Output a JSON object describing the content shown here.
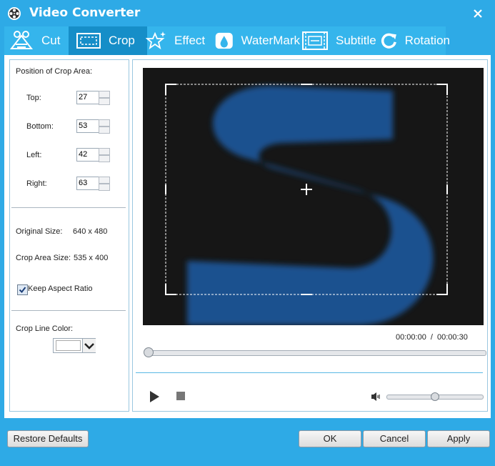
{
  "window": {
    "title": "Video Converter"
  },
  "tabs": [
    {
      "label": "Cut",
      "icon": "cut-icon",
      "active": false
    },
    {
      "label": "Crop",
      "icon": "crop-icon",
      "active": true
    },
    {
      "label": "Effect",
      "icon": "effect-icon",
      "active": false
    },
    {
      "label": "WaterMark",
      "icon": "watermark-icon",
      "active": false
    },
    {
      "label": "Subtitle",
      "icon": "subtitle-icon",
      "active": false
    },
    {
      "label": "Rotation",
      "icon": "rotation-icon",
      "active": false
    }
  ],
  "crop": {
    "section_title": "Position of Crop Area:",
    "fields": [
      {
        "label": "Top:",
        "value": "27"
      },
      {
        "label": "Bottom:",
        "value": "53"
      },
      {
        "label": "Left:",
        "value": "42"
      },
      {
        "label": "Right:",
        "value": "63"
      }
    ],
    "original_size_label": "Original Size:",
    "original_size_value": "640 x 480",
    "crop_size_label": "Crop Area Size:",
    "crop_size_value": "535 x 400",
    "keep_aspect_label": "Keep Aspect Ratio",
    "keep_aspect_checked": true,
    "line_color_label": "Crop Line Color:",
    "line_color": "#ffffff"
  },
  "player": {
    "current_time": "00:00:00",
    "separator": "/",
    "total_time": "00:00:30",
    "progress": 0.0,
    "volume": 0.51
  },
  "buttons": {
    "restore_defaults": "Restore Defaults",
    "ok": "OK",
    "cancel": "Cancel",
    "apply": "Apply"
  },
  "colors": {
    "accent": "#2eaae6",
    "tab_active": "#168ec8",
    "video_bg": "#161616",
    "logo_blue": "#1f5596"
  }
}
